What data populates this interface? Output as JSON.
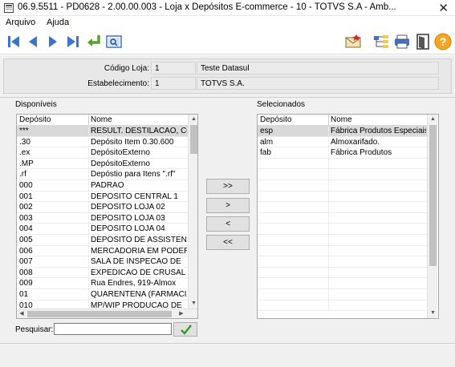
{
  "window": {
    "title": "06.9.5511 - PD0628 - 2.00.00.003 - Loja x Depósitos E-commerce - 10 - TOTVS S.A - Amb...",
    "close_glyph": "✕"
  },
  "menu": {
    "items": [
      "Arquivo",
      "Ajuda"
    ]
  },
  "toolbar": {
    "left_icons": [
      "first-record-icon",
      "previous-record-icon",
      "next-record-icon",
      "last-record-icon",
      "go-to-icon",
      "search-record-icon"
    ],
    "right_icons": [
      "mail-icon",
      "tree-structure-icon",
      "print-icon",
      "exit-door-icon",
      "help-icon"
    ],
    "colors": {
      "nav_blue": "#3d74c9",
      "goto_green": "#5aa02c",
      "help_orange": "#f5a623"
    }
  },
  "header": {
    "codigo_loja_label": "Código Loja:",
    "codigo_loja_value": "1",
    "codigo_loja_desc": "Teste Datasul",
    "estabelecimento_label": "Estabelecimento:",
    "estabelecimento_value": "1",
    "estabelecimento_desc": "TOTVS S.A."
  },
  "disponiveis": {
    "label": "Disponíveis",
    "columns": [
      "Depósito",
      "Nome"
    ],
    "rows": [
      [
        "***",
        "RESULT. DESTILACAO, COL"
      ],
      [
        ".30",
        "Depósito Item 0.30.600"
      ],
      [
        ".ex",
        "DepósitoExterno"
      ],
      [
        ".MP",
        "DepósitoExterno"
      ],
      [
        ".rf",
        "Depóstio para Itens \".rf\""
      ],
      [
        "000",
        "PADRAO"
      ],
      [
        "001",
        "DEPOSITO CENTRAL 1"
      ],
      [
        "002",
        "DEPOSITO LOJA 02"
      ],
      [
        "003",
        "DEPOSITO LOJA 03"
      ],
      [
        "004",
        "DEPOSITO LOJA 04"
      ],
      [
        "005",
        "DEPOSITO DE ASSISTENCIA"
      ],
      [
        "006",
        "MERCADORIA EM PODER"
      ],
      [
        "007",
        "SALA DE INSPECAO DE"
      ],
      [
        "008",
        "EXPEDICAO DE CRUSAL"
      ],
      [
        "009",
        "Rua Endres, 919-Almox"
      ],
      [
        "01",
        "QUARENTENA (FARMACIA)"
      ],
      [
        "010",
        "MP/WIP PRODUCAO DE"
      ]
    ],
    "selected_row": 0
  },
  "selecionados": {
    "label": "Selecionados",
    "columns": [
      "Depósito",
      "Nome"
    ],
    "rows": [
      [
        "esp",
        "Fábrica Produtos Especiais"
      ],
      [
        "alm",
        "Almoxarifado."
      ],
      [
        "fab",
        "Fábrica Produtos"
      ]
    ],
    "empty_rows": 14,
    "selected_row": 0
  },
  "buttons": {
    "add_all": ">>",
    "add_one": ">",
    "remove_one": "<",
    "remove_all": "<<"
  },
  "search": {
    "label": "Pesquisar:",
    "value": "",
    "placeholder": "",
    "confirm_icon": "checkmark-icon"
  }
}
